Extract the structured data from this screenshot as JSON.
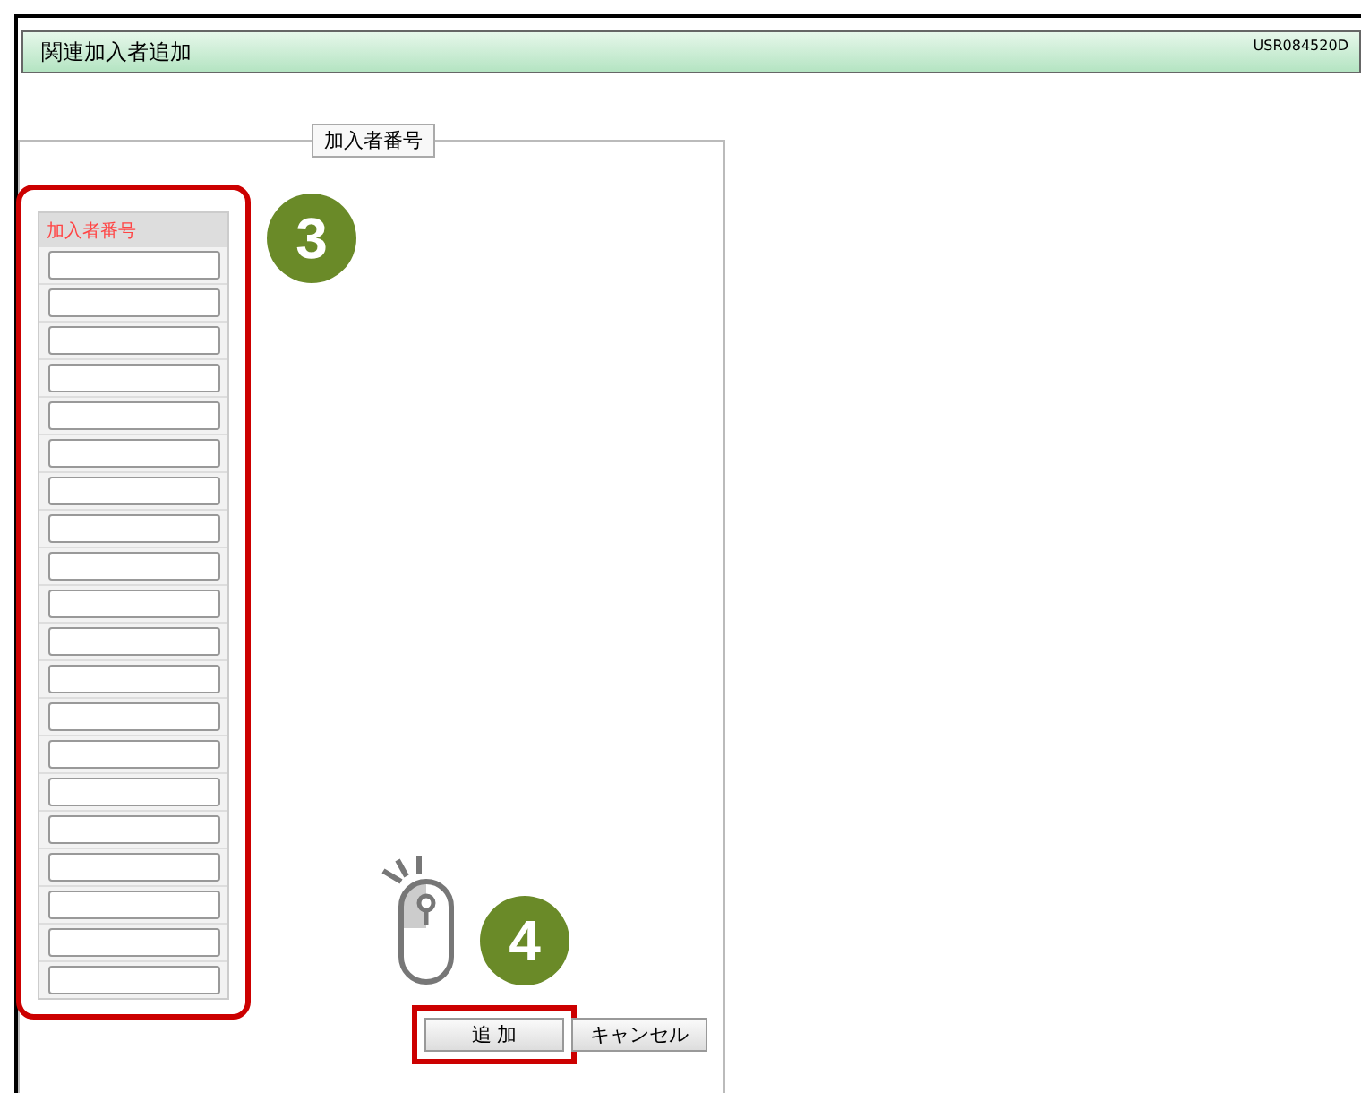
{
  "window": {
    "title": "関連加入者追加",
    "screen_id": "USR084520D"
  },
  "fieldset": {
    "legend": "加入者番号"
  },
  "field_table": {
    "header": "加入者番号",
    "highlighted": true,
    "inputs": [
      {
        "kind": "text"
      },
      {
        "kind": "text"
      },
      {
        "kind": "text"
      },
      {
        "kind": "text"
      },
      {
        "kind": "text"
      },
      {
        "kind": "text"
      },
      {
        "kind": "text"
      },
      {
        "kind": "text"
      },
      {
        "kind": "text"
      },
      {
        "kind": "text"
      },
      {
        "kind": "text"
      },
      {
        "kind": "text"
      },
      {
        "kind": "text"
      },
      {
        "kind": "text"
      },
      {
        "kind": "text"
      },
      {
        "kind": "text"
      },
      {
        "kind": "text"
      },
      {
        "kind": "text"
      },
      {
        "kind": "text"
      },
      {
        "kind": "text"
      }
    ]
  },
  "buttons": [
    {
      "label": "追 加",
      "highlighted": true
    },
    {
      "label": "キャンセル",
      "highlighted": false
    }
  ],
  "callouts": [
    {
      "number": "3",
      "kind": "step"
    },
    {
      "number": "4",
      "kind": "click"
    }
  ]
}
